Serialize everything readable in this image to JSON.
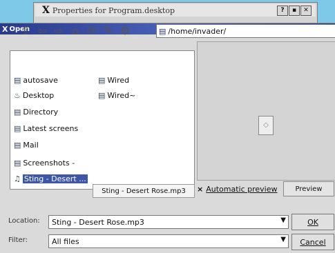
{
  "background_window": {
    "title": "Properties for Program.desktop",
    "buttons": [
      "?",
      "▪",
      "✕"
    ]
  },
  "dialog": {
    "title": "Open",
    "help_label": "?"
  },
  "path": {
    "value": "/home/invader/"
  },
  "files": [
    {
      "label": "autosave",
      "icon": "folder-icon"
    },
    {
      "label": "Desktop",
      "icon": "desktop-icon"
    },
    {
      "label": "Directory",
      "icon": "folder-icon"
    },
    {
      "label": "Latest screens",
      "icon": "folder-icon"
    },
    {
      "label": "Mail",
      "icon": "folder-icon"
    },
    {
      "label": "Screenshots -",
      "icon": "folder-icon"
    },
    {
      "label": "Sting - Desert ...",
      "icon": "audio-file-icon",
      "selected": true
    },
    {
      "label": "Wired",
      "icon": "folder-icon"
    },
    {
      "label": "Wired~",
      "icon": "folder-icon"
    }
  ],
  "tooltip": "Sting - Desert Rose.mp3",
  "preview": {
    "automatic_label": "Automatic preview",
    "button_label": "Preview"
  },
  "location": {
    "label": "Location:",
    "value": "Sting - Desert Rose.mp3"
  },
  "filter": {
    "label": "Filter:",
    "value": "All files"
  },
  "buttons": {
    "ok": "OK",
    "cancel": "Cancel"
  }
}
